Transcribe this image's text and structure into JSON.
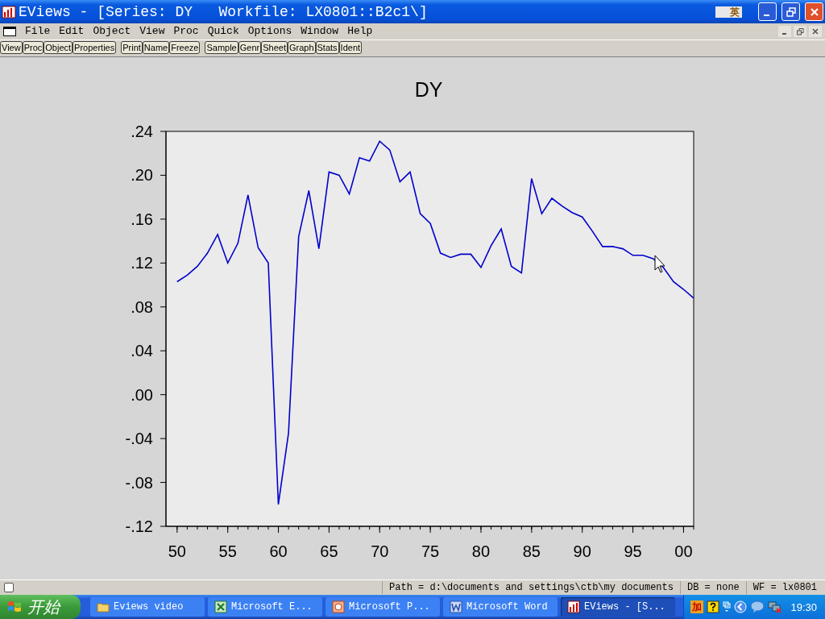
{
  "window": {
    "title": "EViews - [Series: DY   Workfile: LX0801::B2c1\\]",
    "ime_indicator": "英"
  },
  "menu": [
    "File",
    "Edit",
    "Object",
    "View",
    "Proc",
    "Quick",
    "Options",
    "Window",
    "Help"
  ],
  "toolbar": [
    [
      "View",
      "Proc",
      "Object",
      "Properties"
    ],
    [
      "Print",
      "Name",
      "Freeze"
    ],
    [
      "Sample",
      "Genr",
      "Sheet",
      "Graph",
      "Stats",
      "Ident"
    ]
  ],
  "graph": {
    "chart_data": {
      "type": "line",
      "title": "DY",
      "x": [
        1950,
        1951,
        1952,
        1953,
        1954,
        1955,
        1956,
        1957,
        1958,
        1959,
        1960,
        1961,
        1962,
        1963,
        1964,
        1965,
        1966,
        1967,
        1968,
        1969,
        1970,
        1971,
        1972,
        1973,
        1974,
        1975,
        1976,
        1977,
        1978,
        1979,
        1980,
        1981,
        1982,
        1983,
        1984,
        1985,
        1986,
        1987,
        1988,
        1989,
        1990,
        1991,
        1992,
        1993,
        1994,
        1995,
        1996,
        1997,
        1998,
        1999,
        2000,
        2001
      ],
      "series": [
        {
          "color": "#0000cc",
          "values": [
            0.103,
            0.109,
            0.117,
            0.129,
            0.146,
            0.12,
            0.138,
            0.182,
            0.134,
            0.12,
            -0.1,
            -0.035,
            0.144,
            0.186,
            0.133,
            0.203,
            0.2,
            0.183,
            0.216,
            0.213,
            0.231,
            0.223,
            0.194,
            0.203,
            0.165,
            0.156,
            0.129,
            0.125,
            0.128,
            0.128,
            0.116,
            0.136,
            0.151,
            0.117,
            0.111,
            0.197,
            0.165,
            0.179,
            0.172,
            0.166,
            0.162,
            0.149,
            0.135,
            0.135,
            0.133,
            0.127,
            0.127,
            0.124,
            0.116,
            0.103,
            0.096,
            0.088
          ]
        }
      ],
      "xlim": [
        1948.9,
        2001
      ],
      "ylim": [
        -0.12,
        0.24
      ],
      "xticks": [
        {
          "value": 1950,
          "label": "50"
        },
        {
          "value": 1955,
          "label": "55"
        },
        {
          "value": 1960,
          "label": "60"
        },
        {
          "value": 1965,
          "label": "65"
        },
        {
          "value": 1970,
          "label": "70"
        },
        {
          "value": 1975,
          "label": "75"
        },
        {
          "value": 1980,
          "label": "80"
        },
        {
          "value": 1985,
          "label": "85"
        },
        {
          "value": 1990,
          "label": "90"
        },
        {
          "value": 1995,
          "label": "95"
        },
        {
          "value": 2000,
          "label": "00"
        }
      ],
      "yticks": [
        {
          "value": 0.24,
          "label": ".24"
        },
        {
          "value": 0.2,
          "label": ".20"
        },
        {
          "value": 0.16,
          "label": ".16"
        },
        {
          "value": 0.12,
          "label": ".12"
        },
        {
          "value": 0.08,
          "label": ".08"
        },
        {
          "value": 0.04,
          "label": ".04"
        },
        {
          "value": 0,
          "label": ".00"
        },
        {
          "value": -0.04,
          "label": "-.04"
        },
        {
          "value": -0.08,
          "label": "-.08"
        },
        {
          "value": -0.12,
          "label": "-.12"
        }
      ]
    }
  },
  "status_checkbox": {
    "checked": false
  },
  "status_bar": [
    "Path = d:\\documents and settings\\ctb\\my documents",
    "DB = none",
    "WF = lx0801"
  ],
  "taskbar": {
    "start": "开始",
    "tasks": [
      {
        "kind": "folder",
        "label": "Eviews video",
        "selected": false
      },
      {
        "kind": "excel",
        "label": "Microsoft E...",
        "selected": false
      },
      {
        "kind": "powerpoint",
        "label": "Microsoft P...",
        "selected": false
      },
      {
        "kind": "word",
        "label": "Microsoft Word",
        "selected": false
      },
      {
        "kind": "eviews",
        "label": "EViews - [S...",
        "selected": true
      }
    ],
    "tray_ime": "加",
    "clock": "19:30"
  }
}
